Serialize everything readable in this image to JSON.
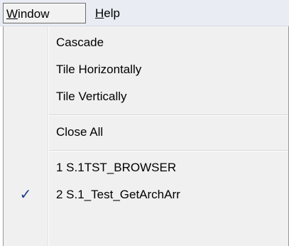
{
  "menubar": {
    "window": {
      "mnemonic": "W",
      "rest": "indow"
    },
    "help": {
      "mnemonic": "H",
      "rest": "elp"
    }
  },
  "window_menu": {
    "items": [
      {
        "label": "Cascade"
      },
      {
        "label": "Tile Horizontally"
      },
      {
        "label": "Tile Vertically"
      },
      {
        "label": "Close All"
      },
      {
        "label": "1 S.1TST_BROWSER",
        "checked": false
      },
      {
        "label": "2 S.1_Test_GetArchArr",
        "checked": true
      }
    ],
    "check_glyph": "✓"
  }
}
